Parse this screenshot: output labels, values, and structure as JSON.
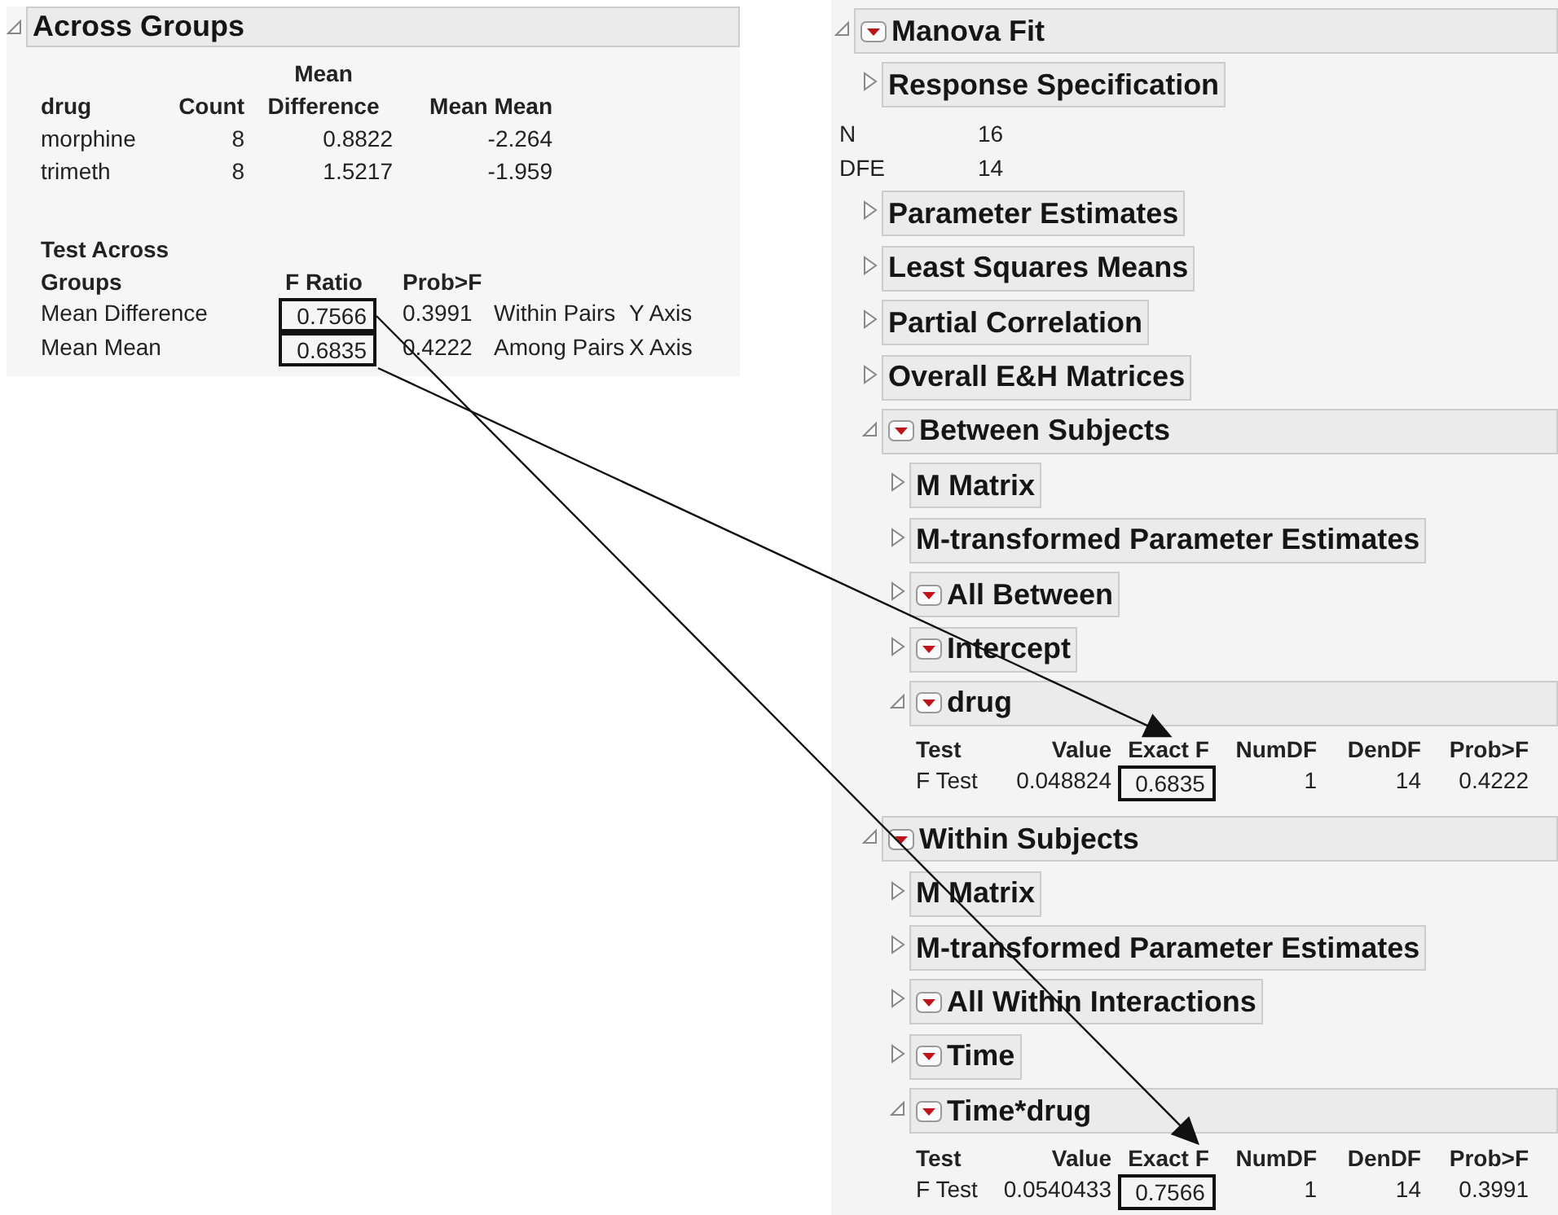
{
  "across_groups": {
    "title": "Across Groups",
    "expanded": true,
    "table": {
      "columns": [
        "drug",
        "Count",
        "Mean\nDifference",
        "Mean Mean"
      ],
      "rows": [
        [
          "morphine",
          "8",
          "0.8822",
          "-2.264"
        ],
        [
          "trimeth",
          "8",
          "1.5217",
          "-1.959"
        ]
      ]
    },
    "tests": {
      "columns": [
        "Test Across\nGroups",
        "F Ratio",
        "Prob>F"
      ],
      "rows": [
        {
          "values": [
            "Mean Difference",
            "0.7566",
            "0.3991",
            "Within Pairs",
            "Y Axis"
          ],
          "boxed": [
            false,
            true,
            false,
            false,
            false
          ]
        },
        {
          "values": [
            "Mean Mean",
            "0.6835",
            "0.4222",
            "Among Pairs",
            "X Axis"
          ],
          "boxed": [
            false,
            true,
            false,
            false,
            false
          ]
        }
      ]
    }
  },
  "manova_fit": {
    "kind": "section",
    "title": "Manova Fit",
    "expanded": true,
    "menu": true,
    "children": [
      {
        "kind": "section",
        "title": "Response Specification",
        "expanded": false,
        "menu": false
      },
      {
        "kind": "stats",
        "rows": [
          [
            "N",
            "16"
          ],
          [
            "DFE",
            "14"
          ]
        ]
      },
      {
        "kind": "section",
        "title": "Parameter Estimates",
        "expanded": false,
        "menu": false
      },
      {
        "kind": "section",
        "title": "Least Squares Means",
        "expanded": false,
        "menu": false
      },
      {
        "kind": "section",
        "title": "Partial Correlation",
        "expanded": false,
        "menu": false
      },
      {
        "kind": "section",
        "title": "Overall E&H Matrices",
        "expanded": false,
        "menu": false
      },
      {
        "kind": "section",
        "title": "Between Subjects",
        "expanded": true,
        "menu": true,
        "children": [
          {
            "kind": "section",
            "title": "M Matrix",
            "expanded": false,
            "menu": false
          },
          {
            "kind": "section",
            "title": "M-transformed Parameter Estimates",
            "expanded": false,
            "menu": false
          },
          {
            "kind": "section",
            "title": "All Between",
            "expanded": false,
            "menu": true
          },
          {
            "kind": "section",
            "title": "Intercept",
            "expanded": false,
            "menu": true
          },
          {
            "kind": "section",
            "title": "drug",
            "expanded": true,
            "menu": true,
            "children": [
              {
                "kind": "table",
                "columns": [
                  "Test",
                  "Value",
                  "Exact F",
                  "NumDF",
                  "DenDF",
                  "Prob>F"
                ],
                "rows": [
                  {
                    "values": [
                      "F Test",
                      "0.048824",
                      "0.6835",
                      "1",
                      "14",
                      "0.4222"
                    ],
                    "boxed": [
                      false,
                      false,
                      true,
                      false,
                      false,
                      false
                    ]
                  }
                ]
              }
            ]
          }
        ]
      },
      {
        "kind": "section",
        "title": "Within Subjects",
        "expanded": true,
        "menu": true,
        "children": [
          {
            "kind": "section",
            "title": "M Matrix",
            "expanded": false,
            "menu": false
          },
          {
            "kind": "section",
            "title": "M-transformed Parameter Estimates",
            "expanded": false,
            "menu": false
          },
          {
            "kind": "section",
            "title": "All Within Interactions",
            "expanded": false,
            "menu": true
          },
          {
            "kind": "section",
            "title": "Time",
            "expanded": false,
            "menu": true
          },
          {
            "kind": "section",
            "title": "Time*drug",
            "expanded": true,
            "menu": true,
            "children": [
              {
                "kind": "table",
                "columns": [
                  "Test",
                  "Value",
                  "Exact F",
                  "NumDF",
                  "DenDF",
                  "Prob>F"
                ],
                "rows": [
                  {
                    "values": [
                      "F Test",
                      "0.0540433",
                      "0.7566",
                      "1",
                      "14",
                      "0.3991"
                    ],
                    "boxed": [
                      false,
                      false,
                      true,
                      false,
                      false,
                      false
                    ]
                  }
                ]
              }
            ]
          }
        ]
      }
    ]
  }
}
